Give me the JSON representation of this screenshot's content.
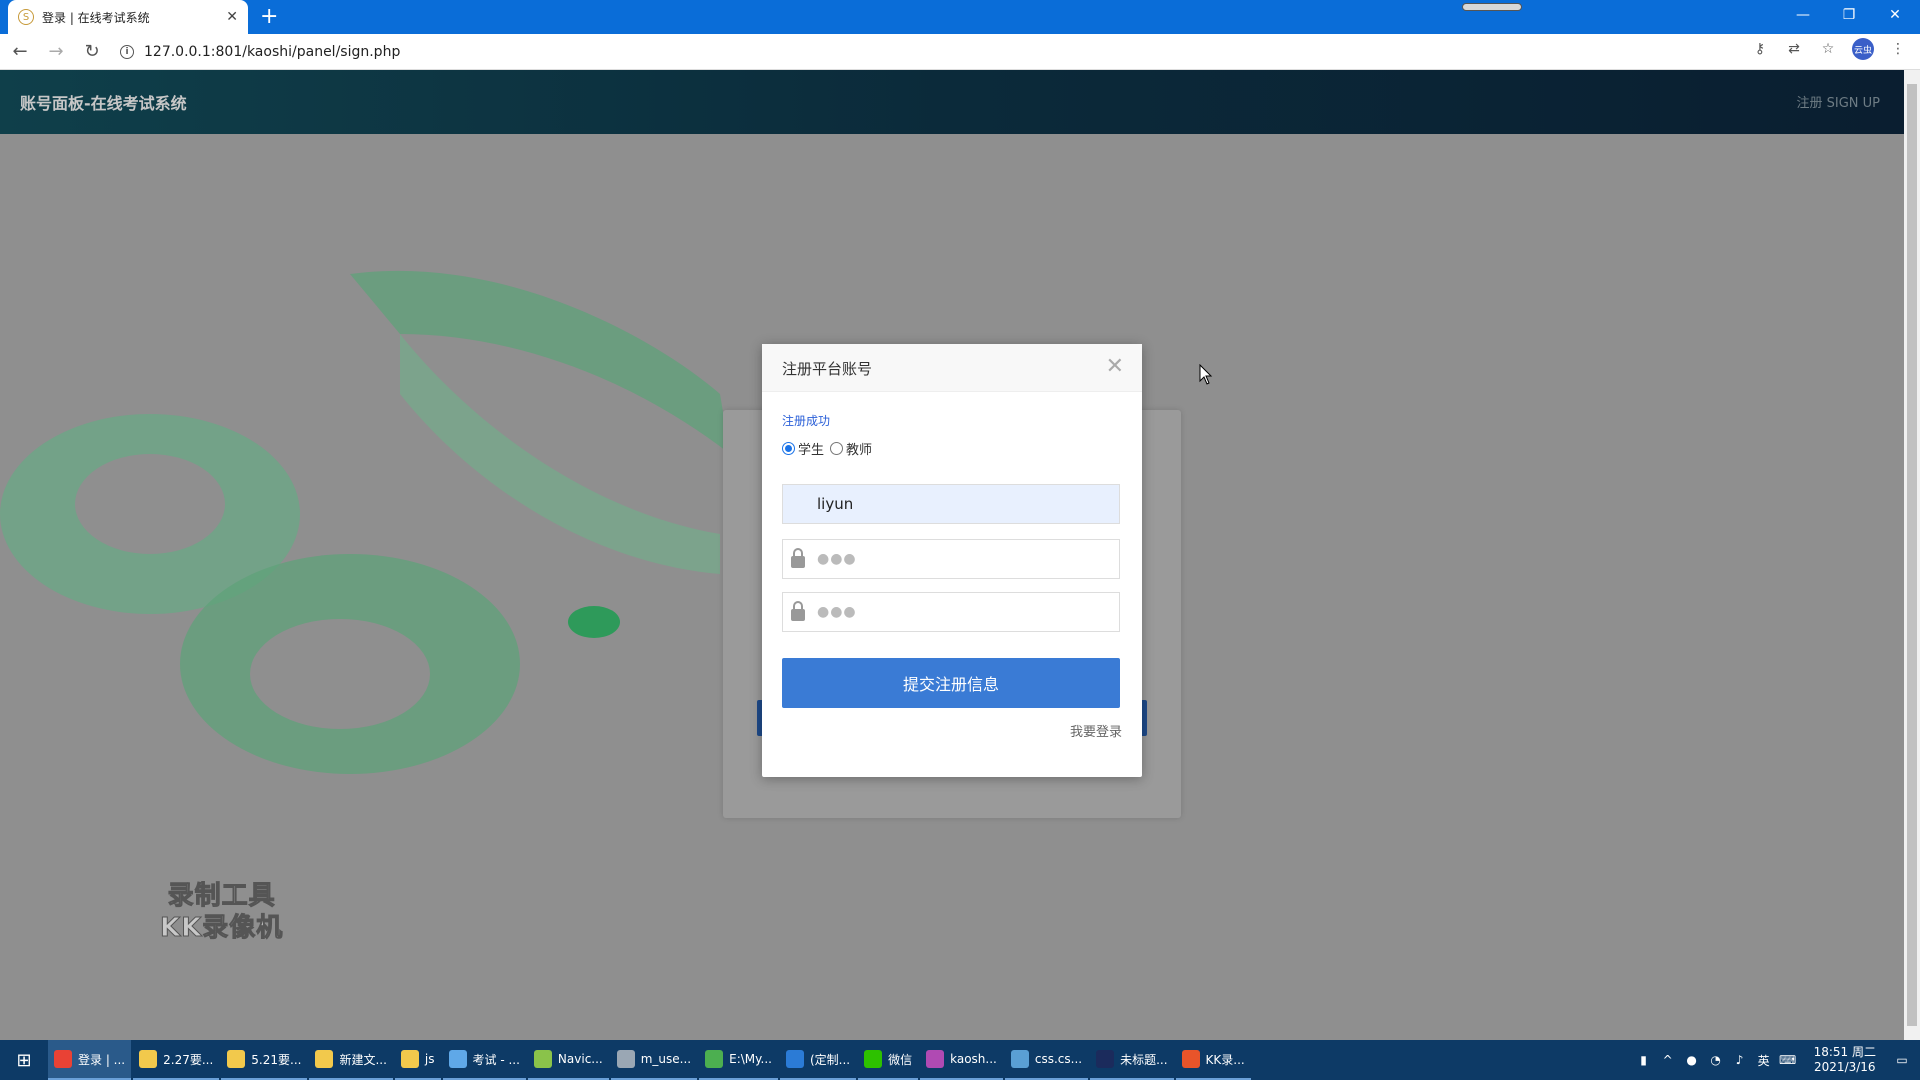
{
  "browser": {
    "tab_title": "登录 | 在线考试系统",
    "tab_close": "✕",
    "new_tab": "+",
    "url": "127.0.0.1:801/kaoshi/panel/sign.php",
    "profile_label": "云虫",
    "window_min": "—",
    "window_restore": "❐",
    "window_close": "✕"
  },
  "header": {
    "brand": "账号面板-在线考试系统",
    "nav_signup": "注册  SIGN UP"
  },
  "modal": {
    "title": "注册平台账号",
    "close": "✕",
    "status": "注册成功",
    "role_student": "学生",
    "role_teacher": "教师",
    "selected_role": "学生",
    "username_value": "liyun",
    "password_dots": "●●●",
    "confirm_dots": "●●●",
    "submit_label": "提交注册信息",
    "login_link": "我要登录"
  },
  "watermark": {
    "line1": "录制工具",
    "line2": "KK录像机"
  },
  "taskbar": {
    "items": [
      {
        "label": "登录 | ...",
        "color": "#e94235",
        "active": true
      },
      {
        "label": "2.27要...",
        "color": "#f2c94c"
      },
      {
        "label": "5.21要...",
        "color": "#f2c94c"
      },
      {
        "label": "新建文...",
        "color": "#f2c94c"
      },
      {
        "label": "js",
        "color": "#f2c94c"
      },
      {
        "label": "考试 - ...",
        "color": "#5fa8e8"
      },
      {
        "label": "Navic...",
        "color": "#8ac34a"
      },
      {
        "label": "m_use...",
        "color": "#9aa7b4"
      },
      {
        "label": "E:\\My...",
        "color": "#4caf50"
      },
      {
        "label": "(定制...",
        "color": "#2b7bd6"
      },
      {
        "label": "微信",
        "color": "#2dc100"
      },
      {
        "label": "kaosh...",
        "color": "#b04ab3"
      },
      {
        "label": "css.cs...",
        "color": "#5a9fd4"
      },
      {
        "label": "未标题...",
        "color": "#1b2b5c"
      },
      {
        "label": "KK录...",
        "color": "#e8542a"
      }
    ],
    "time": "18:51 周二",
    "date": "2021/3/16",
    "ime": "英"
  }
}
